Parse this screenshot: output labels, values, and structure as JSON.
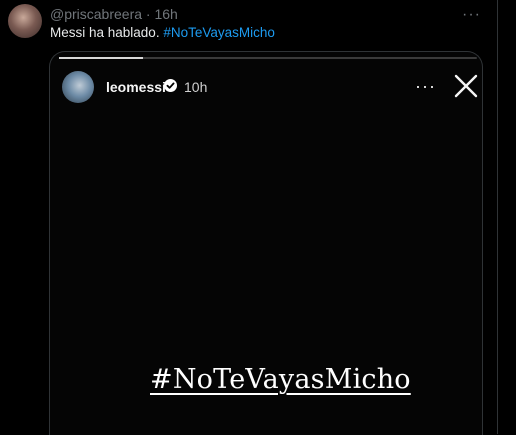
{
  "tweet": {
    "handle": "@priscabreera",
    "separator": "·",
    "time": "16h",
    "more_icon": "more-horizontal-icon",
    "text": "Messi ha hablado.",
    "hashtag": "#NoTeVayasMicho"
  },
  "story": {
    "progress": 0.2,
    "username": "leomessi",
    "verified_icon": "verified-badge-icon",
    "time": "10h",
    "more_icon": "more-horizontal-icon",
    "close_icon": "close-icon",
    "hashtag": "#NoTeVayasMicho"
  },
  "colors": {
    "background": "#000000",
    "text": "#e7e9ea",
    "muted": "#71767b",
    "link": "#1d9bf0",
    "border": "#2f3336"
  }
}
